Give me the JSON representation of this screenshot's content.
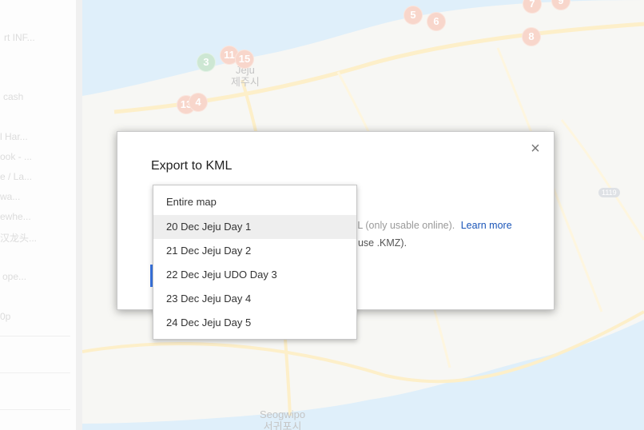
{
  "sidebar": {
    "items": [
      "rt INF...",
      "cash",
      "l Har...",
      "ook - ...",
      "e / La...",
      "wa...",
      "ewhe...",
      "汉龙头...",
      "ope...",
      "0p"
    ]
  },
  "map": {
    "labels": {
      "city_en": "Jeju",
      "city_ko": "제주시",
      "south_en": "Seogwipo",
      "south_ko": "서귀포시",
      "road": "1119"
    },
    "markers": [
      "5",
      "6",
      "7",
      "9",
      "8",
      "3",
      "11",
      "15",
      "13",
      "4"
    ]
  },
  "dialog": {
    "title": "Export to KML",
    "close_icon": "close-icon",
    "description_fragment": "ML (only usable online).",
    "learn_more": "Learn more",
    "description_fragment2": ", use .KMZ)."
  },
  "dropdown": {
    "options": [
      "Entire map",
      "20 Dec Jeju Day 1",
      "21 Dec Jeju Day 2",
      "22 Dec Jeju UDO Day 3",
      "23 Dec Jeju Day 4",
      "24 Dec Jeju Day 5"
    ],
    "highlighted": "20 Dec Jeju Day 1"
  },
  "colors": {
    "marker": "#f3b9a5",
    "marker_green": "#a9d6b3",
    "link": "#1a55b8",
    "accent": "#3b78e7"
  }
}
